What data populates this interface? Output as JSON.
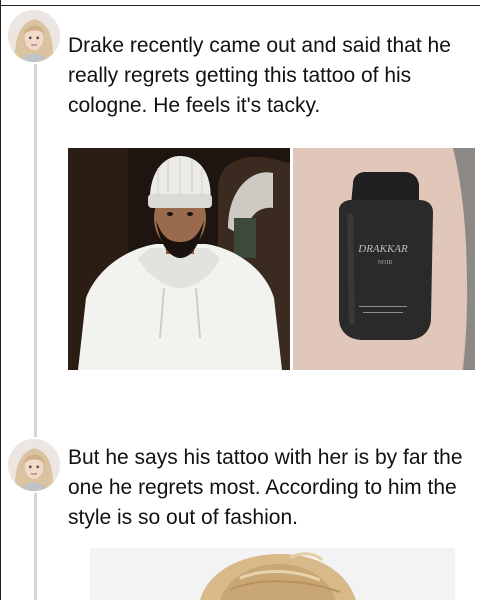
{
  "thread": {
    "posts": [
      {
        "text": "Drake recently came out and said that he really regrets getting this tattoo of his cologne. He feels it's tacky.",
        "images": [
          {
            "icon": "photo-drake-white-hoodie"
          },
          {
            "icon": "photo-cologne-bottle-tattoo",
            "tattoo_label": "DRAKKAR",
            "tattoo_sublabel": "NOIR"
          }
        ]
      },
      {
        "text": "But he says his tattoo with her is by far the one he regrets most. According to him the style is so out of fashion.",
        "images": [
          {
            "icon": "photo-blonde-hair-partial"
          }
        ]
      }
    ]
  },
  "colors": {
    "thread_line": "#d6d6d6",
    "text": "#111111"
  }
}
